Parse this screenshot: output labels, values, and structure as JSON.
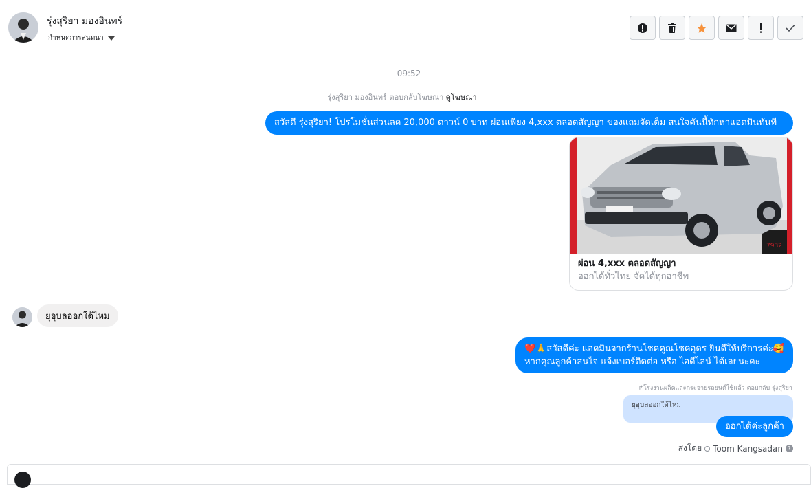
{
  "header": {
    "contact_name": "รุ่งสุริยา มองอินทร์",
    "assign_label": "กำหนดการสนทนา"
  },
  "toolbar": {
    "buttons": [
      {
        "icon": "alert-circle-icon"
      },
      {
        "icon": "trash-icon"
      },
      {
        "icon": "star-icon",
        "color": "#f7923b"
      },
      {
        "icon": "mail-icon"
      },
      {
        "icon": "exclamation-icon"
      },
      {
        "icon": "check-icon"
      }
    ]
  },
  "thread": {
    "timestamp": "09:52",
    "ad_reply_text": "รุ่งสุริยา มองอินทร์ ตอบกลับโฆษณา",
    "ad_reply_link": "ดูโฆษณา",
    "msg1": "สวัสดี รุ่งสุริยา! โปรโมชั่นส่วนลด 20,000 ดาวน์ 0 บาท ผ่อนเพียง 4,xxx ตลอดสัญญา ของแถมจัดเต็ม สนใจคันนี้ทักหาแอดมินทันที",
    "card": {
      "title": "ผ่อน 4,xxx ตลอดสัญญา",
      "subtitle": "ออกได้ทั่วไทย จัดได้ทุกอาชีพ"
    },
    "msg_in": "ยุอุบลออกใด้ไหม",
    "msg2_line1": "❤️🙏สวัสดีค่ะ แอดมินจากร้านโชคคูณโชคอุดร ยินดีให้บริการค่ะ🥰",
    "msg2_line2": "หากคุณลูกค้าสนใจ แจ้งเบอร์ติดต่อ หรือ ไอดีไลน์ ได้เลยนะคะ",
    "reply_meta": "↱โรงงานผลิตและกระจายรถยนต์ใช้แล้ว ตอบกลับ รุ่งสุริยา",
    "quoted_text": "ยุอุบลออกใด้ไหม",
    "msg3": "ออกได้ค่ะลูกค้า",
    "sent_by_label": "ส่งโดย",
    "sent_by_name": "Toom Kangsadan"
  },
  "colors": {
    "accent": "#0084ff",
    "incoming": "#f1f0f0"
  }
}
